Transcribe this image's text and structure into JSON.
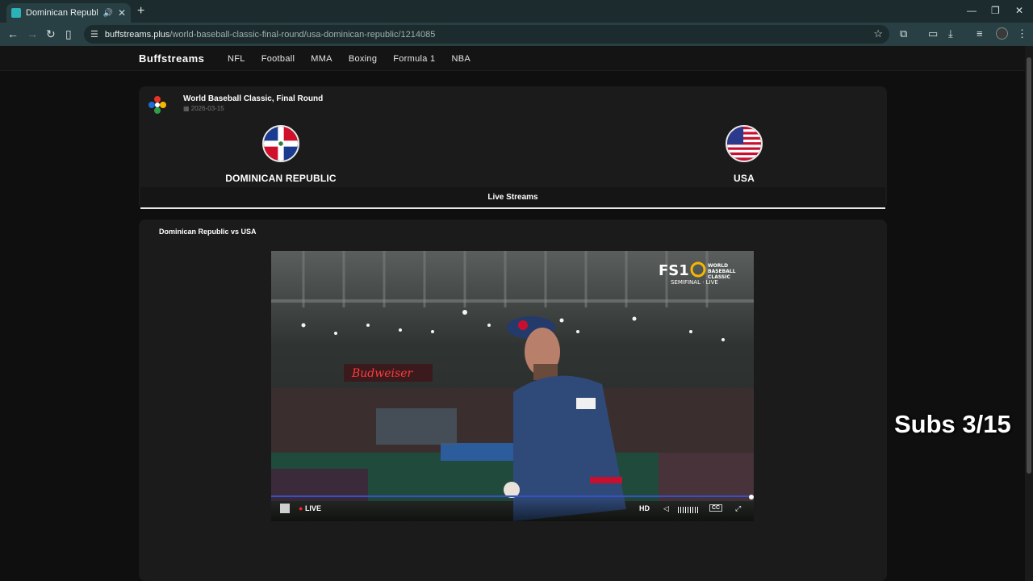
{
  "browser": {
    "tab_title": "Dominican Republic vs USA",
    "url_domain": "buffstreams.plus",
    "url_path": "/world-baseball-classic-final-round/usa-dominican-republic/1214085"
  },
  "site": {
    "brand": "Buffstreams",
    "nav": [
      "NFL",
      "Football",
      "MMA",
      "Boxing",
      "Formula 1",
      "NBA"
    ]
  },
  "event": {
    "title": "World Baseball Classic, Final Round",
    "date": "2026-03-15",
    "home_team": "DOMINICAN REPUBLIC",
    "away_team": "USA"
  },
  "streams": {
    "tab_label": "Live Streams",
    "stream_title": "Dominican Republic vs USA"
  },
  "player": {
    "network": "FS1",
    "bug_line1": "WORLD",
    "bug_line2": "BASEBALL",
    "bug_line3": "CLASSIC",
    "bug_status": "SEMIFINAL · LIVE",
    "live_label": "LIVE",
    "quality_label": "HD",
    "cc_label": "CC",
    "progress": 1.0
  },
  "overlay": {
    "subs_text": "Subs 3/15"
  }
}
